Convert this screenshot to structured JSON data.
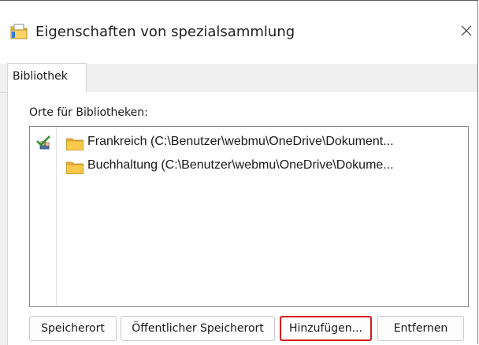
{
  "window": {
    "title": "Eigenschaften von spezialsammlung",
    "close_glyph": "×"
  },
  "tabs": [
    {
      "label": "Bibliothek",
      "selected": true
    }
  ],
  "library": {
    "locations_label": "Orte für Bibliotheken:",
    "locations": [
      {
        "text": "Frankreich (C:\\Benutzer\\webmu\\OneDrive\\Dokument...",
        "is_default": true,
        "icon": "folder-icon"
      },
      {
        "text": "Buchhaltung (C:\\Benutzer\\webmu\\OneDrive\\Dokume...",
        "is_default": false,
        "icon": "folder-icon"
      }
    ]
  },
  "buttons": {
    "set_save_location": "Speicherort",
    "set_public_save_location": "Öffentlicher Speicherort",
    "add": "Hinzufügen...",
    "remove": "Entfernen"
  },
  "colors": {
    "highlight_border": "#d41a1a",
    "folder_yellow": "#f8c94a",
    "default_check_green": "#2e8b2e"
  }
}
